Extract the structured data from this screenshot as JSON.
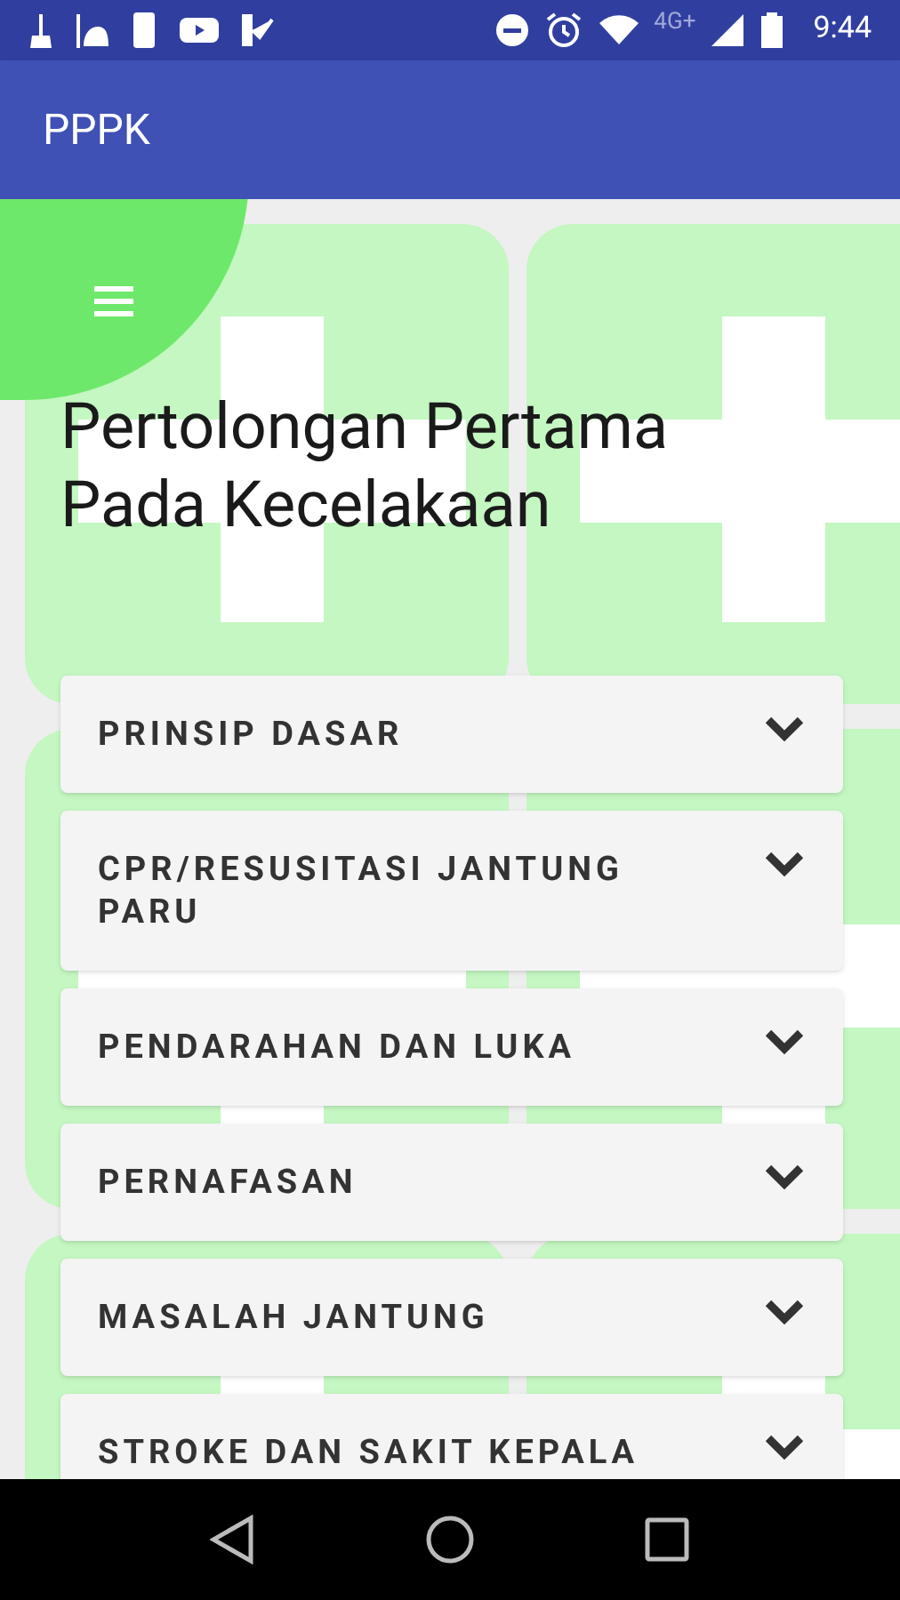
{
  "status_bar": {
    "network": "4G+",
    "time": "9:44"
  },
  "app_bar": {
    "title": "PPPK"
  },
  "heading": "Pertolongan Pertama Pada Kecelakaan",
  "sections": [
    {
      "label": "PRINSIP DASAR"
    },
    {
      "label": "CPR/RESUSITASI JANTUNG PARU"
    },
    {
      "label": "PENDARAHAN DAN LUKA"
    },
    {
      "label": "PERNAFASAN"
    },
    {
      "label": "MASALAH JANTUNG"
    },
    {
      "label": "STROKE DAN SAKIT KEPALA"
    }
  ]
}
